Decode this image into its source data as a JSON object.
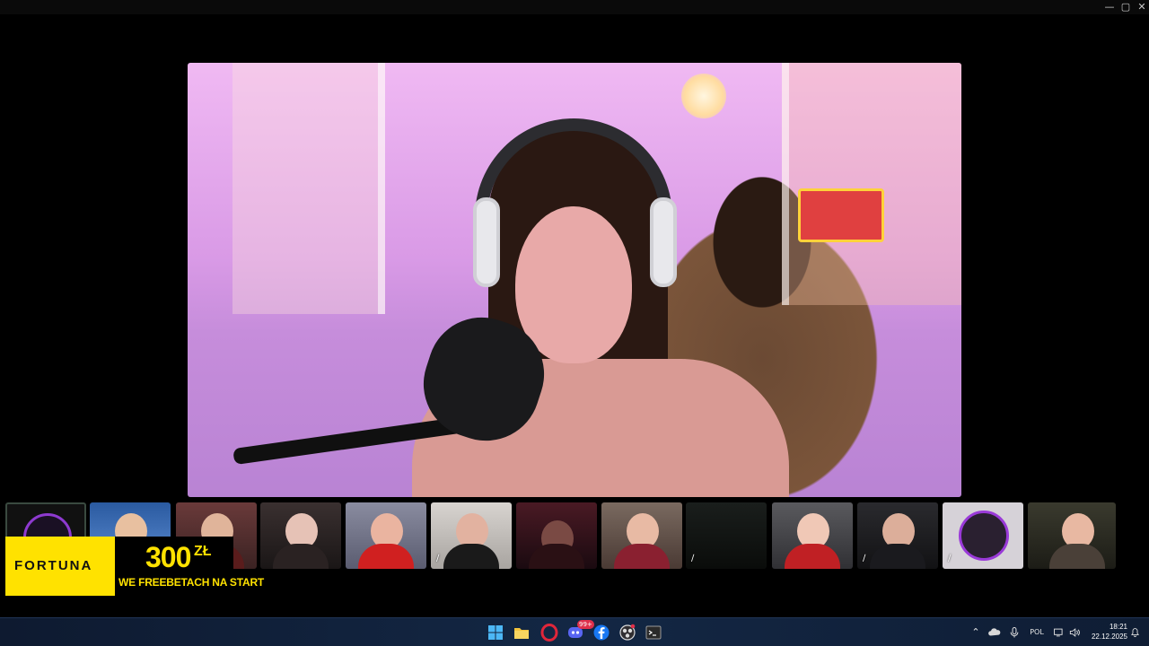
{
  "window": {
    "controls": {
      "minimize": "—",
      "maximize": "▢",
      "close": "✕"
    }
  },
  "main_video": {
    "icon": "speaker-video"
  },
  "participants": [
    {
      "name": "camera-off-avatar",
      "indicator": ""
    },
    {
      "name": "participant-santa",
      "indicator": ""
    },
    {
      "name": "participant-christmas-room",
      "indicator": ""
    },
    {
      "name": "participant-dark-hair",
      "indicator": ""
    },
    {
      "name": "participant-headset-red",
      "indicator": ""
    },
    {
      "name": "participant-brunette",
      "indicator": "∕"
    },
    {
      "name": "participant-dark-room",
      "indicator": ""
    },
    {
      "name": "participant-with-cat",
      "indicator": ""
    },
    {
      "name": "participant-dark-tree",
      "indicator": "∕"
    },
    {
      "name": "participant-blonde-headset",
      "indicator": ""
    },
    {
      "name": "participant-studio-foam",
      "indicator": "∕"
    },
    {
      "name": "participant-avatar-purple",
      "indicator": "∕"
    },
    {
      "name": "participant-glasses",
      "indicator": ""
    }
  ],
  "ad": {
    "brand": "FORTUNA",
    "amount": "300",
    "currency": "ZŁ",
    "subtitle": "WE FREEBETACH NA START",
    "fine_print": "",
    "colors": {
      "yellow": "#ffe200",
      "black": "#000000"
    }
  },
  "taskbar": {
    "icons": [
      "windows-start",
      "file-explorer",
      "opera",
      "discord",
      "facebook",
      "obs",
      "terminal"
    ],
    "discord_badge": "99+",
    "language": "POL",
    "time": "18:21",
    "date": "22.12.2025"
  }
}
